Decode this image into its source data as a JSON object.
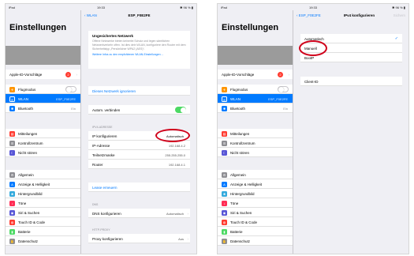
{
  "left": {
    "status": {
      "left": "iPad",
      "time": "19:33",
      "right": "✱ 96 % ▮"
    },
    "master": {
      "title": "Einstellungen",
      "apple_id": {
        "label": "Apple-ID-Vorschläge",
        "badge": "2"
      },
      "group1": [
        {
          "label": "Flugmodus",
          "icon_color": "#ff9500",
          "icon": "✈"
        },
        {
          "label": "WLAN",
          "value": "ESP_F0E2FE",
          "icon_color": "#007aff",
          "icon": "◎"
        },
        {
          "label": "Bluetooth",
          "value": "Ein",
          "icon_color": "#007aff",
          "icon": "✱"
        }
      ],
      "group2": [
        {
          "label": "Mitteilungen",
          "icon_color": "#ff3b30",
          "icon": "▤"
        },
        {
          "label": "Kontrollzentrum",
          "icon_color": "#8e8e93",
          "icon": "☰"
        },
        {
          "label": "Nicht stören",
          "icon_color": "#5856d6",
          "icon": "☾"
        }
      ],
      "group3": [
        {
          "label": "Allgemein",
          "icon_color": "#8e8e93",
          "icon": "⚙"
        },
        {
          "label": "Anzeige & Helligkeit",
          "icon_color": "#007aff",
          "icon": "A"
        },
        {
          "label": "Hintergrundbild",
          "icon_color": "#34aadc",
          "icon": "❀"
        },
        {
          "label": "Töne",
          "icon_color": "#ff2d55",
          "icon": "♪"
        },
        {
          "label": "Siri & Suchen",
          "icon_color": "#5856d6",
          "icon": "◉"
        },
        {
          "label": "Touch ID & Code",
          "icon_color": "#ff3b30",
          "icon": "◍"
        },
        {
          "label": "Batterie",
          "icon_color": "#4cd964",
          "icon": "▮"
        },
        {
          "label": "Datenschutz",
          "icon_color": "#8e8e93",
          "icon": "✋"
        }
      ]
    },
    "detail": {
      "back": "WLAN",
      "title": "ESP_F0E2FE",
      "warning": {
        "title": "Ungesichertes Netzwerk",
        "text": "Offene Netzwerke bieten keinerlei Schutz und legen sämtlichen Netzwerkverkehr offen. Ist dies dein WLAN, konfiguriere den Router mit dem Sicherheitstyp „Persönlicher WPA2 (AES)“.",
        "link": "Weitere Infos zu den empfohlenen WLAN-Einstellungen ..."
      },
      "ignore": "Dieses Netzwerk ignorieren",
      "auto_join": "Autom. verbinden",
      "ipv4_header": "IPV4-ADRESSE",
      "ipv4_rows": [
        {
          "label": "IP konfigurieren",
          "value": "Automatisch"
        },
        {
          "label": "IP-Adresse",
          "value": "192.168.4.2"
        },
        {
          "label": "Teilnetzmaske",
          "value": "255.255.255.0"
        },
        {
          "label": "Router",
          "value": "192.168.4.1"
        }
      ],
      "lease": "Lease erneuern",
      "dns_header": "DNS",
      "dns": {
        "label": "DNS konfigurieren",
        "value": "Automatisch"
      },
      "proxy_header": "HTTP-PROXY",
      "proxy": {
        "label": "Proxy konfigurieren",
        "value": "Aus"
      }
    }
  },
  "right": {
    "status": {
      "left": "iPad",
      "time": "19:33",
      "right": "✱ 96 % ▮"
    },
    "detail": {
      "back": "ESP_F0E2FE",
      "title": "IPv4 konfigurieren",
      "save": "Sichern",
      "options": [
        "Automatisch",
        "Manuell",
        "BootP"
      ],
      "client_id": "Client-ID"
    }
  },
  "colors": {
    "accent": "#007aff",
    "annotation": "#d0021b",
    "toggle_on": "#4cd964"
  }
}
